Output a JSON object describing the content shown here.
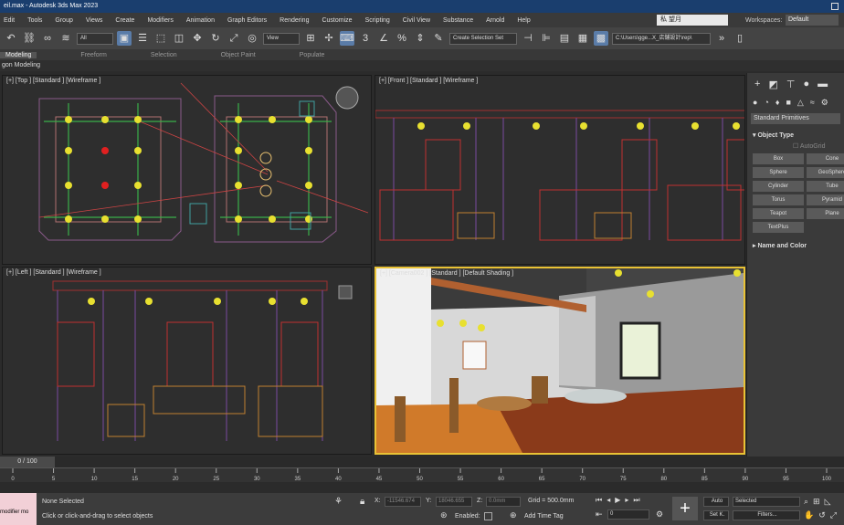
{
  "title": "eil.max - Autodesk 3ds Max 2023",
  "menu": [
    "Edit",
    "Tools",
    "Group",
    "Views",
    "Create",
    "Modifiers",
    "Animation",
    "Graph Editors",
    "Rendering",
    "Customize",
    "Scripting",
    "Civil View",
    "Substance",
    "Arnold",
    "Help"
  ],
  "user": "私 望月",
  "workspaces_label": "Workspaces:",
  "workspaces_value": "Default",
  "toolbar": {
    "filter": "All",
    "view": "View",
    "selset": "Create Selection Set",
    "path": "C:\\Users\\gge...X_店舗設計\\rep\\"
  },
  "ribbon": {
    "tabs": [
      "Modeling",
      "Freeform",
      "Selection",
      "Object Paint",
      "Populate"
    ],
    "sub": "gon Modeling"
  },
  "viewports": {
    "top": "[+] [Top ] [Standard ] [Wireframe ]",
    "front": "[+] [Front ] [Standard ] [Wireframe ]",
    "left": "[+] [Left ] [Standard ] [Wireframe ]",
    "camera": "[+] [Camera002 ] [Standard ] [Default Shading ]"
  },
  "command_panel": {
    "category": "Standard Primitives",
    "object_type": "Object Type",
    "autogrid": "AutoGrid",
    "buttons": [
      "Box",
      "Cone",
      "Sphere",
      "GeoSphere",
      "Cylinder",
      "Tube",
      "Torus",
      "Pyramid",
      "Teapot",
      "Plane",
      "TextPlus"
    ],
    "name_color": "Name and Color"
  },
  "timeline": {
    "frame": "0 / 100",
    "ticks": [
      "0",
      "5",
      "10",
      "15",
      "20",
      "25",
      "30",
      "35",
      "40",
      "45",
      "50",
      "55",
      "60",
      "65",
      "70",
      "75",
      "80",
      "85",
      "90",
      "95",
      "100"
    ]
  },
  "status": {
    "modifier": "modifier mo",
    "selected": "None Selected",
    "prompt": "Click or click-and-drag to select objects",
    "x_label": "X:",
    "x": "-11546.674",
    "y_label": "Y:",
    "y": "18046.655",
    "z_label": "Z:",
    "z": "0.0mm",
    "grid": "Grid = 500.0mm",
    "enabled": "Enabled:",
    "add_time_tag": "Add Time Tag",
    "auto": "Auto",
    "set_key": "Set K.",
    "selected_dd": "Selected",
    "filters": "Filters...",
    "frame_field": "0"
  }
}
